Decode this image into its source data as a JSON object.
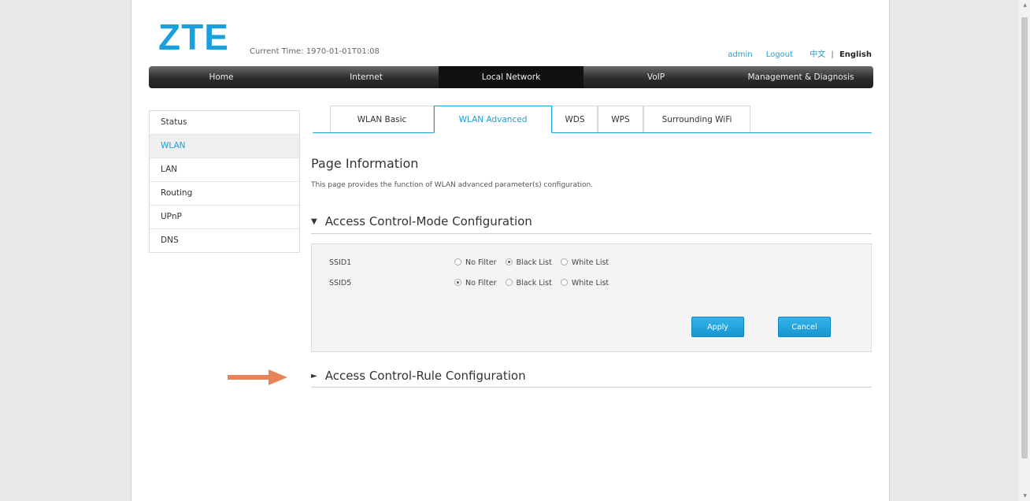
{
  "header": {
    "logo": "ZTE",
    "current_time": "Current Time: 1970-01-01T01:08",
    "user": "admin",
    "logout": "Logout",
    "lang_cn": "中文",
    "lang_sep": "|",
    "lang_en": "English"
  },
  "nav": {
    "items": [
      "Home",
      "Internet",
      "Local Network",
      "VoIP",
      "Management & Diagnosis"
    ],
    "active": "Local Network"
  },
  "sidebar": {
    "items": [
      "Status",
      "WLAN",
      "LAN",
      "Routing",
      "UPnP",
      "DNS"
    ],
    "active": "WLAN"
  },
  "tabs": {
    "items": [
      "WLAN Basic",
      "WLAN Advanced",
      "WDS",
      "WPS",
      "Surrounding WiFi"
    ],
    "active": "WLAN Advanced"
  },
  "page": {
    "title": "Page Information",
    "description": "This page provides the function of WLAN advanced parameter(s) configuration."
  },
  "sections": {
    "mode": {
      "title": "Access Control-Mode Configuration",
      "expanded": true
    },
    "rule": {
      "title": "Access Control-Rule Configuration",
      "expanded": false
    }
  },
  "options": [
    "No Filter",
    "Black List",
    "White List"
  ],
  "ssids": [
    {
      "name": "SSID1",
      "selected": "Black List"
    },
    {
      "name": "SSID5",
      "selected": "No Filter"
    }
  ],
  "buttons": {
    "apply": "Apply",
    "cancel": "Cancel"
  },
  "colors": {
    "accent": "#1aa0dc",
    "annotation_arrow": "#e8845a"
  }
}
